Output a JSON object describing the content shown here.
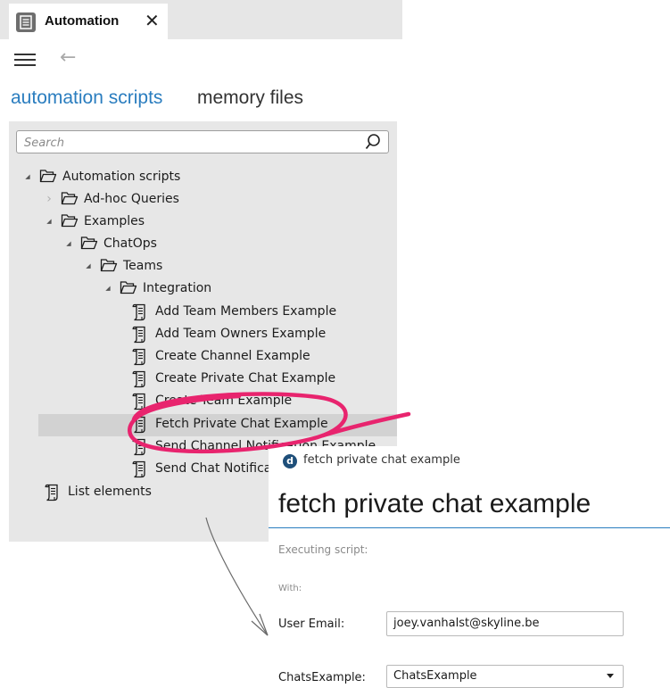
{
  "window": {
    "tab_title": "Automation",
    "close_glyph": "✕",
    "back_glyph": "←"
  },
  "view_tabs": {
    "active": "automation scripts",
    "inactive": "memory files"
  },
  "search": {
    "placeholder": "Search"
  },
  "tree": {
    "nodes": [
      {
        "label": "Automation scripts",
        "type": "folder",
        "expander": "expanded"
      },
      {
        "label": "Ad-hoc Queries",
        "type": "folder",
        "expander": "collapsed"
      },
      {
        "label": "Examples",
        "type": "folder",
        "expander": "expanded"
      },
      {
        "label": "ChatOps",
        "type": "folder",
        "expander": "expanded"
      },
      {
        "label": "Teams",
        "type": "folder",
        "expander": "expanded"
      },
      {
        "label": "Integration",
        "type": "folder",
        "expander": "expanded"
      },
      {
        "label": "Add Team Members Example",
        "type": "script"
      },
      {
        "label": "Add Team Owners Example",
        "type": "script"
      },
      {
        "label": "Create Channel Example",
        "type": "script"
      },
      {
        "label": "Create Private Chat Example",
        "type": "script"
      },
      {
        "label": "Create Team Example",
        "type": "script"
      },
      {
        "label": "Fetch Private Chat Example",
        "type": "script",
        "selected": true
      },
      {
        "label": "Send Channel Notification Example",
        "type": "script"
      },
      {
        "label": "Send Chat Notification Example",
        "type": "script"
      },
      {
        "label": "List elements",
        "type": "script"
      }
    ]
  },
  "dialog": {
    "logo_letter": "d",
    "small_title": "fetch private chat example",
    "big_title": "fetch private chat example",
    "executing_label": "Executing script:",
    "with_label": "With:",
    "user_email_label": "User Email:",
    "user_email_value": "joey.vanhalst@skyline.be",
    "chats_label": "ChatsExample:",
    "chats_value": "ChatsExample"
  },
  "colors": {
    "accent": "#2a7dbf",
    "annotation": "#e8246e",
    "panel_bg": "#e7e7e7",
    "selected_row": "#d2d2d2"
  },
  "icons": {
    "tab": "script-document-icon",
    "menu": "hamburger-menu-icon",
    "back": "back-arrow-icon",
    "search": "magnifier-icon",
    "folder": "open-folder-icon",
    "script": "script-document-icon"
  }
}
